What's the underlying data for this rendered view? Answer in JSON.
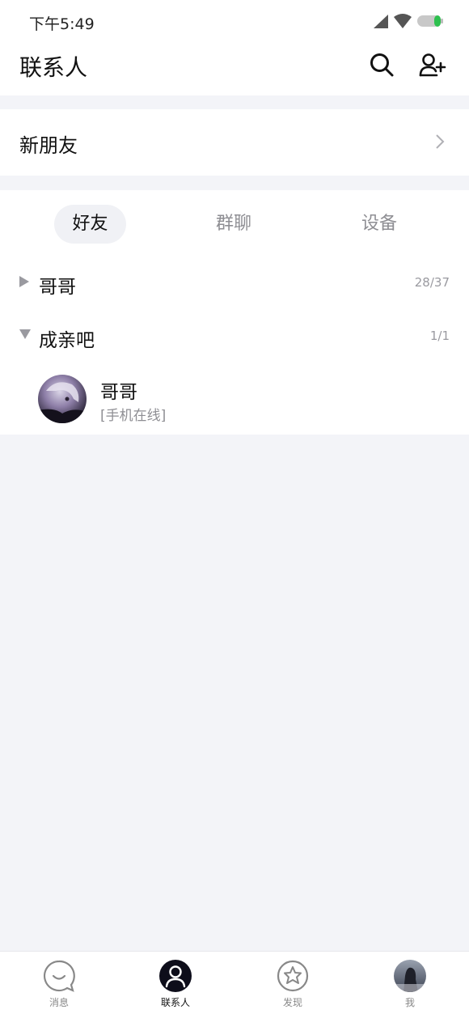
{
  "status_bar": {
    "time": "下午5:49"
  },
  "header": {
    "title": "联系人",
    "search_icon": "search-icon",
    "add_icon": "add-contact-icon"
  },
  "new_friends": {
    "label": "新朋友"
  },
  "tabs": [
    {
      "label": "好友",
      "active": true
    },
    {
      "label": "群聊",
      "active": false
    },
    {
      "label": "设备",
      "active": false
    }
  ],
  "groups": [
    {
      "name": "哥哥",
      "count": "28/37",
      "expanded": false
    },
    {
      "name": "成亲吧",
      "count": "1/1",
      "expanded": true
    }
  ],
  "contacts": [
    {
      "name": "哥哥",
      "status": "[手机在线]"
    }
  ],
  "bottom_nav": [
    {
      "label": "消息",
      "icon": "message-icon",
      "active": false
    },
    {
      "label": "联系人",
      "icon": "contacts-icon",
      "active": true
    },
    {
      "label": "发现",
      "icon": "discover-star-icon",
      "active": false
    },
    {
      "label": "我",
      "icon": "profile-avatar",
      "active": false
    }
  ],
  "colors": {
    "battery": "#2ec04f",
    "background": "#f3f4f8",
    "active_tab_bg": "#f0f1f5"
  }
}
